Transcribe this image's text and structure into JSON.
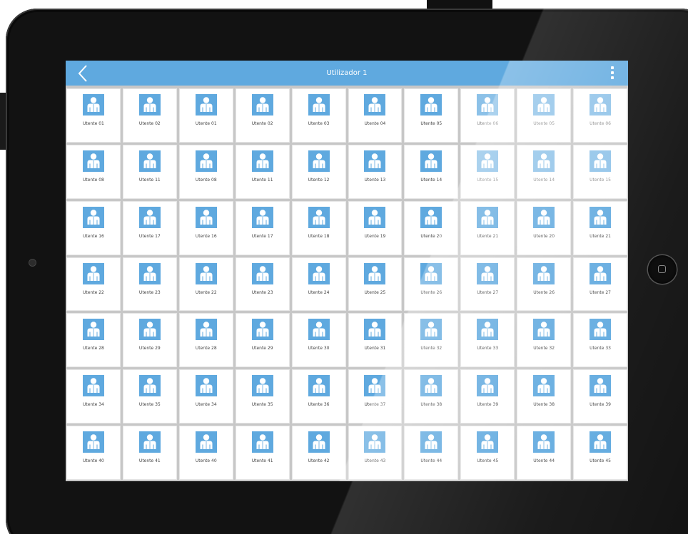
{
  "header": {
    "title": "Utilizador 1",
    "back_icon": "chevron-left-icon",
    "menu_icon": "kebab-menu-icon"
  },
  "colors": {
    "accent": "#5fa9df",
    "tile_background": "#ffffff",
    "grid_background": "#c7c7c7",
    "device_frame": "#121212"
  },
  "tile_icon": "person-avatar-icon",
  "users": [
    [
      "Utente 01",
      "Utente 02",
      "Utente 01",
      "Utente 02",
      "Utente 03",
      "Utente 04",
      "Utente 05",
      "Utente 06",
      "Utente 05",
      "Utente 06"
    ],
    [
      "Utente 08",
      "Utente 11",
      "Utente 08",
      "Utente 11",
      "Utente 12",
      "Utente 13",
      "Utente 14",
      "Utente 15",
      "Utente 14",
      "Utente 15"
    ],
    [
      "Utente 16",
      "Utente 17",
      "Utente 16",
      "Utente 17",
      "Utente 18",
      "Utente 19",
      "Utente 20",
      "Utente 21",
      "Utente 20",
      "Utente 21"
    ],
    [
      "Utente 22",
      "Utente 23",
      "Utente 22",
      "Utente 23",
      "Utente 24",
      "Utente 25",
      "Utente 26",
      "Utente 27",
      "Utente 26",
      "Utente 27"
    ],
    [
      "Utente 28",
      "Utente 29",
      "Utente 28",
      "Utente 29",
      "Utente 30",
      "Utente 31",
      "Utente 32",
      "Utente 33",
      "Utente 32",
      "Utente 33"
    ],
    [
      "Utente 34",
      "Utente 35",
      "Utente 34",
      "Utente 35",
      "Utente 36",
      "Utente 37",
      "Utente 38",
      "Utente 39",
      "Utente 38",
      "Utente 39"
    ],
    [
      "Utente 40",
      "Utente 41",
      "Utente 40",
      "Utente 41",
      "Utente 42",
      "Utente 43",
      "Utente 44",
      "Utente 45",
      "Utente 44",
      "Utente 45"
    ]
  ]
}
